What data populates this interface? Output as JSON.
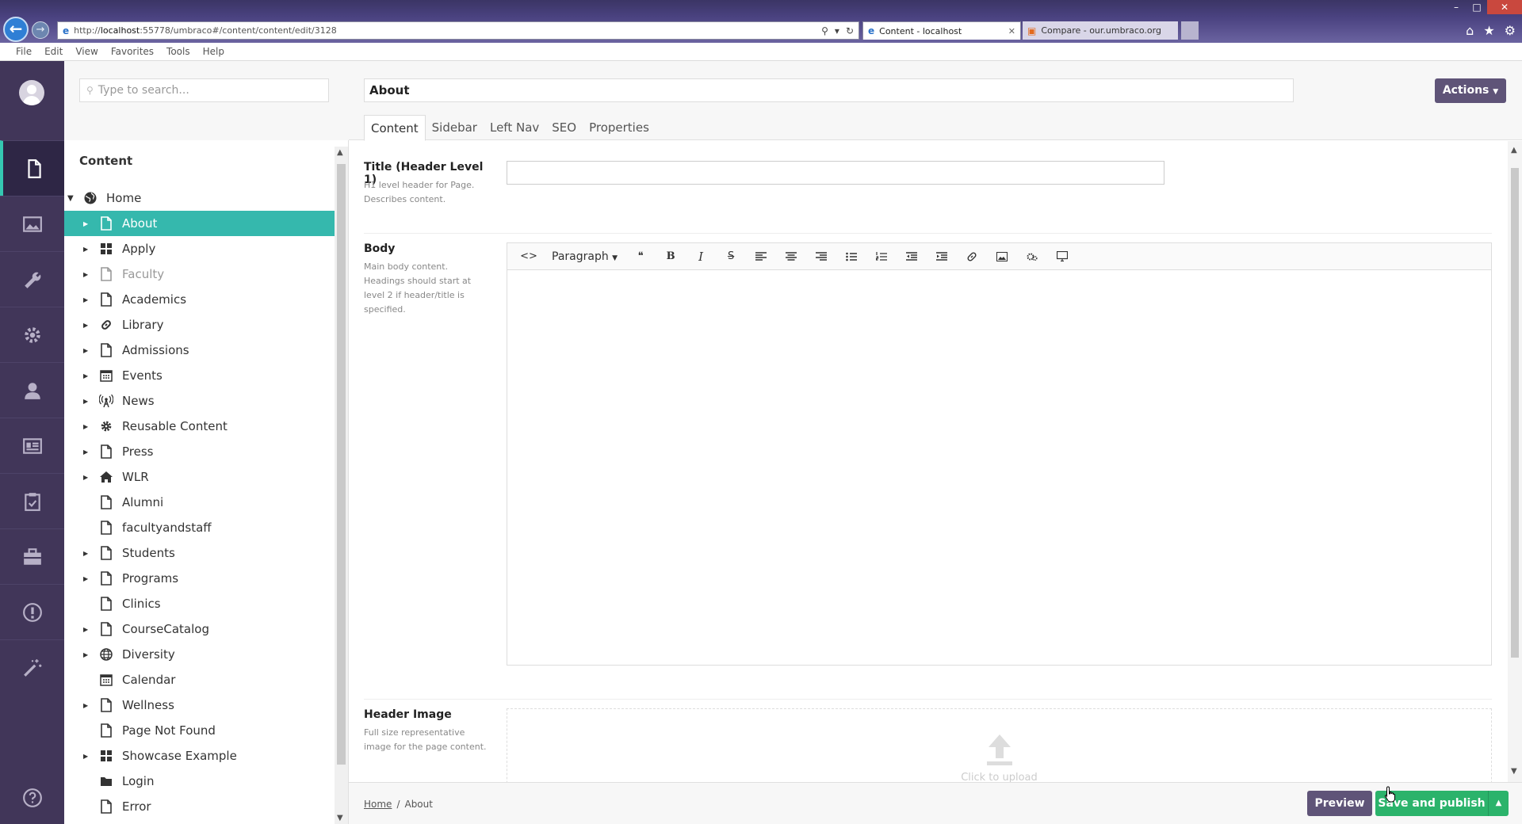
{
  "browser": {
    "url_prefix": "http://",
    "url_host": "localhost",
    "url_rest": ":55778/umbraco#/content/content/edit/3128",
    "tabs": [
      {
        "label": "Content - localhost",
        "active": true
      },
      {
        "label": "Compare - our.umbraco.org",
        "active": false
      }
    ],
    "menu": [
      "File",
      "Edit",
      "View",
      "Favorites",
      "Tools",
      "Help"
    ]
  },
  "sections": [
    {
      "name": "content",
      "icon": "document-icon",
      "active": true
    },
    {
      "name": "media",
      "icon": "image-icon",
      "active": false
    },
    {
      "name": "settings",
      "icon": "wrench-icon",
      "active": false
    },
    {
      "name": "developer",
      "icon": "gear-icon",
      "active": false
    },
    {
      "name": "users",
      "icon": "user-icon",
      "active": false
    },
    {
      "name": "members",
      "icon": "id-card-icon",
      "active": false
    },
    {
      "name": "forms",
      "icon": "clipboard-icon",
      "active": false
    },
    {
      "name": "packages",
      "icon": "briefcase-icon",
      "active": false
    },
    {
      "name": "info",
      "icon": "info-icon",
      "active": false
    },
    {
      "name": "wizard",
      "icon": "magic-wand-icon",
      "active": false
    }
  ],
  "tree": {
    "search_placeholder": "Type to search...",
    "title": "Content",
    "root": "Home",
    "items": [
      {
        "label": "About",
        "icon": "document-icon",
        "caret": true,
        "selected": true
      },
      {
        "label": "Apply",
        "icon": "grid-icon",
        "caret": true
      },
      {
        "label": "Faculty",
        "icon": "document-icon",
        "caret": true,
        "faded": true
      },
      {
        "label": "Academics",
        "icon": "document-icon",
        "caret": true
      },
      {
        "label": "Library",
        "icon": "link-icon",
        "caret": true
      },
      {
        "label": "Admissions",
        "icon": "document-icon",
        "caret": true
      },
      {
        "label": "Events",
        "icon": "calendar-icon",
        "caret": true
      },
      {
        "label": "News",
        "icon": "broadcast-icon",
        "caret": true
      },
      {
        "label": "Reusable Content",
        "icon": "gear-icon",
        "caret": true
      },
      {
        "label": "Press",
        "icon": "document-icon",
        "caret": true
      },
      {
        "label": "WLR",
        "icon": "home-icon",
        "caret": true
      },
      {
        "label": "Alumni",
        "icon": "document-icon",
        "caret": false
      },
      {
        "label": "facultyandstaff",
        "icon": "document-icon",
        "caret": false
      },
      {
        "label": "Students",
        "icon": "document-icon",
        "caret": true
      },
      {
        "label": "Programs",
        "icon": "document-icon",
        "caret": true
      },
      {
        "label": "Clinics",
        "icon": "document-icon",
        "caret": false
      },
      {
        "label": "CourseCatalog",
        "icon": "document-icon",
        "caret": true
      },
      {
        "label": "Diversity",
        "icon": "globe-icon",
        "caret": true
      },
      {
        "label": "Calendar",
        "icon": "calendar-icon",
        "caret": false
      },
      {
        "label": "Wellness",
        "icon": "document-icon",
        "caret": true
      },
      {
        "label": "Page Not Found",
        "icon": "document-icon",
        "caret": false
      },
      {
        "label": "Showcase Example",
        "icon": "grid-icon",
        "caret": true
      },
      {
        "label": "Login",
        "icon": "folder-icon",
        "caret": false
      },
      {
        "label": "Error",
        "icon": "document-icon",
        "caret": false
      }
    ]
  },
  "editor": {
    "name": "About",
    "actions_label": "Actions",
    "tabs": [
      "Content",
      "Sidebar",
      "Left Nav",
      "SEO",
      "Properties"
    ],
    "properties": {
      "title": {
        "label": "Title (Header Level 1)",
        "desc": "H1 level header for Page. Describes content.",
        "value": ""
      },
      "body": {
        "label": "Body",
        "desc": "Main body content. Headings should start at level 2 if header/title is specified.",
        "format": "Paragraph"
      },
      "header_image": {
        "label": "Header Image",
        "desc": "Full size representative image for the page content.",
        "upload_text": "Click to upload"
      }
    }
  },
  "footer": {
    "breadcrumb": [
      "Home",
      "About"
    ],
    "preview_label": "Preview",
    "publish_label": "Save and publish"
  },
  "colors": {
    "sections_bg": "#413659",
    "selected_node": "#35b8ad",
    "publish": "#2bb36b",
    "secondary_button": "#5f5478"
  }
}
